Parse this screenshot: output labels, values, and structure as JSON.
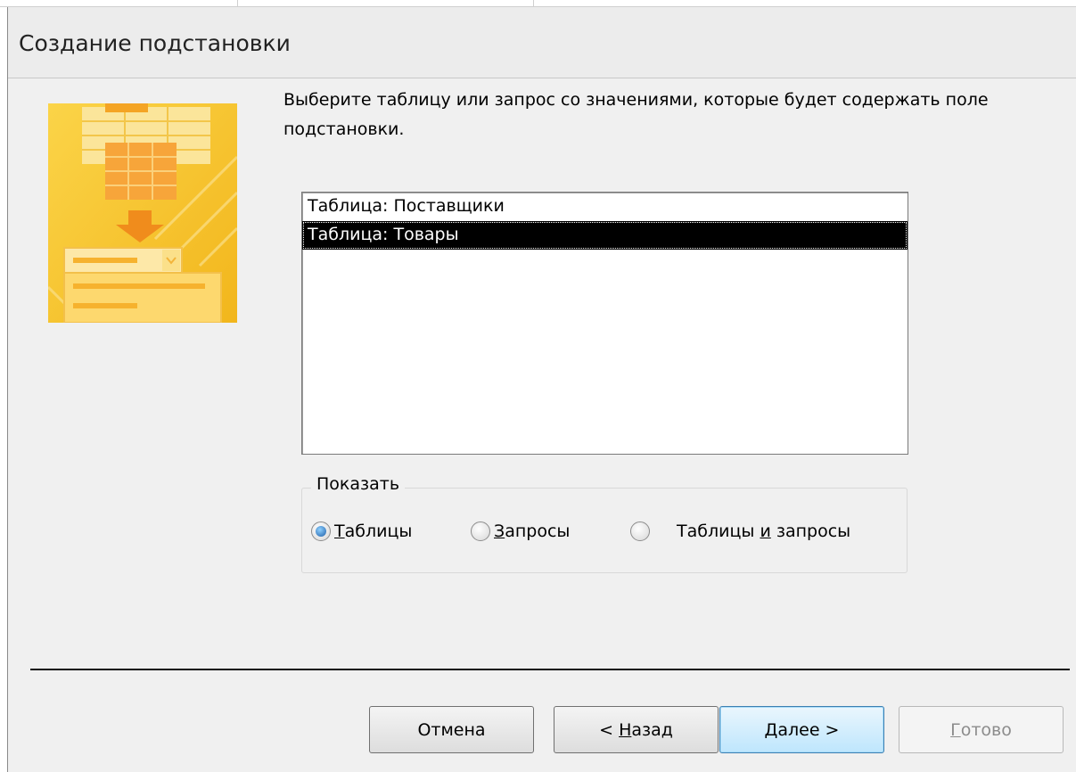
{
  "dialog": {
    "title": "Создание подстановки"
  },
  "instructions": "Выберите таблицу или запрос со значениями, которые будет содержать поле подстановки.",
  "list": {
    "items": [
      "Таблица: Поставщики",
      "Таблица: Товары"
    ],
    "selected_index": 1
  },
  "show_group": {
    "legend": "Показать",
    "options": [
      {
        "mnemonic": "Т",
        "rest": "аблицы",
        "checked": true
      },
      {
        "mnemonic": "З",
        "rest": "апросы",
        "checked": false
      },
      {
        "before": "Таблицы ",
        "mnemonic": "и",
        "after": " запросы",
        "checked": false
      }
    ]
  },
  "buttons": {
    "cancel": "Отмена",
    "back_prefix": "< ",
    "back_mnemonic": "Н",
    "back_rest": "азад",
    "next_mnemonic": "Д",
    "next_rest": "алее >",
    "finish_mnemonic": "Г",
    "finish_rest": "отово"
  },
  "colors": {
    "illustration_yellow": "#f6c325",
    "illustration_arrow": "#f08c1c",
    "selection": "#000000",
    "default_button": "#bee6fd"
  }
}
